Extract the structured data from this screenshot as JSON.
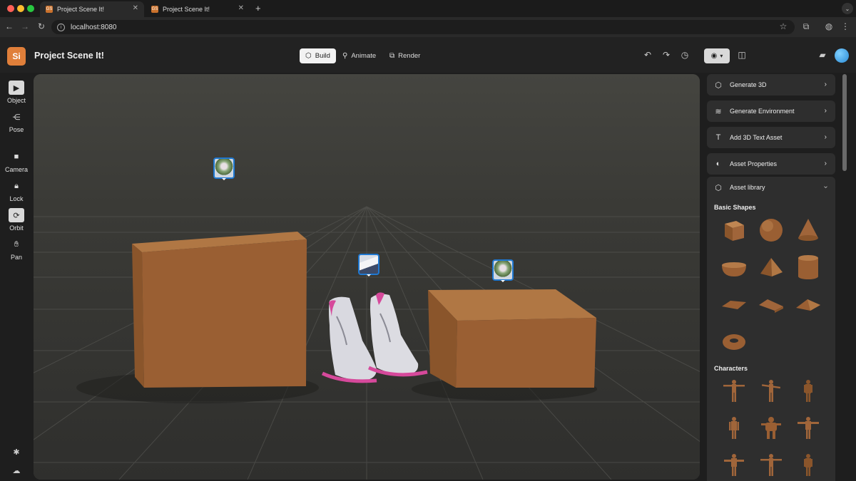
{
  "browser": {
    "tabs": [
      {
        "title": "Project Scene It!",
        "favicon": "GS",
        "active": true
      },
      {
        "title": "Project Scene It!",
        "favicon": "GS",
        "active": false
      }
    ],
    "new_tab_icon": "+",
    "address": "localhost:8080"
  },
  "app": {
    "logo": "Si",
    "title": "Project Scene It!",
    "modes": [
      {
        "label": "Build",
        "icon": "cube-icon",
        "active": true
      },
      {
        "label": "Animate",
        "icon": "animate-icon",
        "active": false
      },
      {
        "label": "Render",
        "icon": "render-icon",
        "active": false
      }
    ]
  },
  "left_toolbar": [
    {
      "label": "Object",
      "icon": "cursor-icon",
      "selected": true
    },
    {
      "label": "Pose",
      "icon": "pose-icon",
      "selected": false
    },
    {
      "label": "Camera",
      "icon": "camera-icon",
      "selected": false
    },
    {
      "label": "Lock",
      "icon": "lock-icon",
      "selected": false
    },
    {
      "label": "Orbit",
      "icon": "orbit-icon",
      "selected": true
    },
    {
      "label": "Pan",
      "icon": "hand-icon",
      "selected": false
    }
  ],
  "right_panel": {
    "cards": [
      {
        "label": "Generate 3D",
        "icon": "cube-sparkle-icon"
      },
      {
        "label": "Generate Environment",
        "icon": "layers-icon"
      },
      {
        "label": "Add 3D Text Asset",
        "icon": "text-3d-icon"
      },
      {
        "label": "Asset Properties",
        "icon": "palette-icon"
      }
    ],
    "library": {
      "label": "Asset library",
      "icon": "box-icon",
      "sections": [
        "Basic Shapes",
        "Characters"
      ]
    }
  },
  "colors": {
    "accent_orange": "#e07f3a",
    "box_brown": "#9a5f33",
    "pin_blue": "#1f78d1"
  }
}
